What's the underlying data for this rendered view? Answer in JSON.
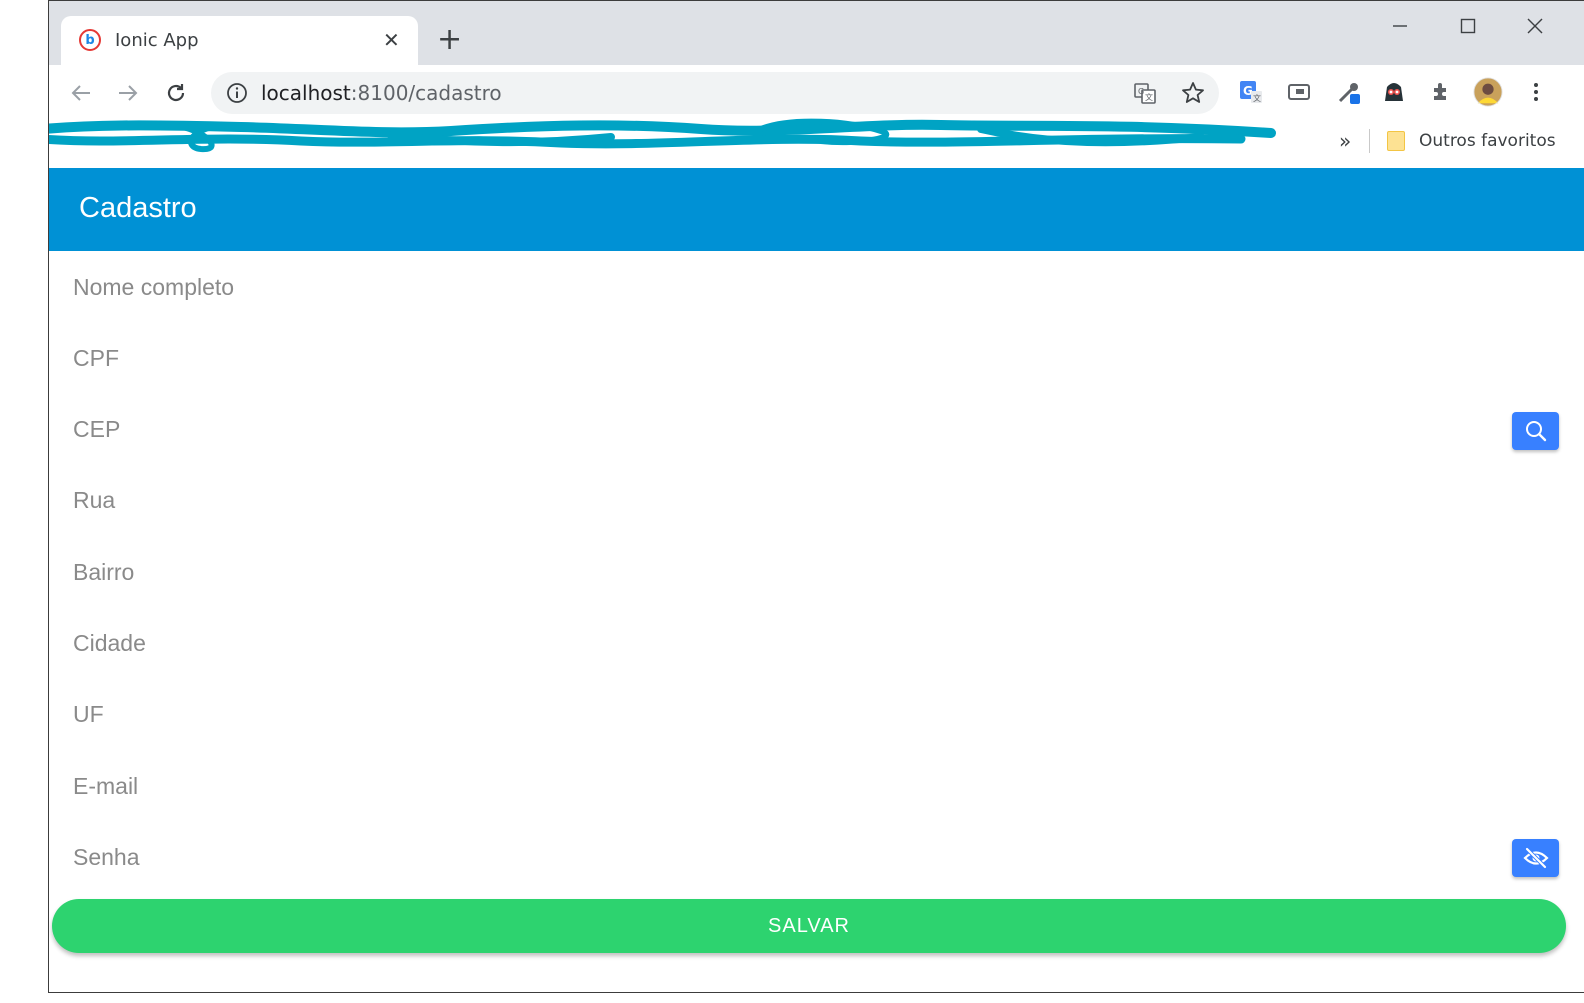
{
  "browser": {
    "tab": {
      "title": "Ionic App",
      "close_glyph": "✕"
    },
    "new_tab_glyph": "+",
    "omnibox": {
      "host": "localhost",
      "path": ":8100/cadastro"
    },
    "bookmarks": {
      "more_glyph": "»",
      "folder_label": "Outros favoritos"
    }
  },
  "app": {
    "title": "Cadastro",
    "fields": [
      {
        "placeholder": "Nome completo"
      },
      {
        "placeholder": "CPF"
      },
      {
        "placeholder": "CEP"
      },
      {
        "placeholder": "Rua"
      },
      {
        "placeholder": "Bairro"
      },
      {
        "placeholder": "Cidade"
      },
      {
        "placeholder": "UF"
      },
      {
        "placeholder": "E-mail"
      },
      {
        "placeholder": "Senha"
      }
    ],
    "save_label": "SALVAR"
  },
  "colors": {
    "header": "#0091d5",
    "field_button": "#3880ff",
    "save_button": "#2dd36f",
    "scribble": "#00a3c4"
  }
}
